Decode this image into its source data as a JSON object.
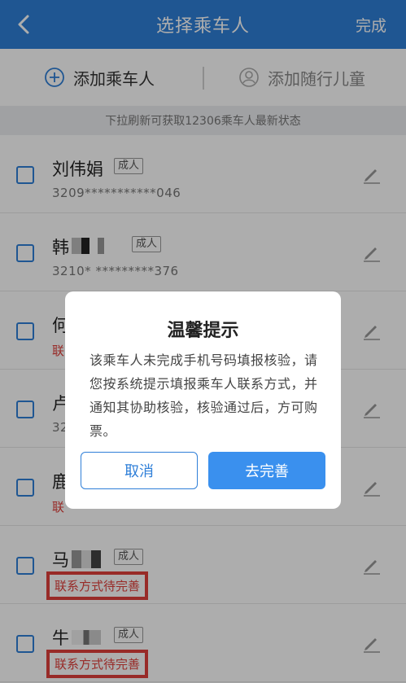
{
  "nav": {
    "title": "选择乘车人",
    "done_label": "完成"
  },
  "actions": {
    "add_passenger": "添加乘车人",
    "add_child": "添加随行儿童"
  },
  "tip": "下拉刷新可获取12306乘车人最新状态",
  "passengers": [
    {
      "name": "刘伟娟",
      "badge": "成人",
      "id": "3209***********046"
    },
    {
      "name": "韩",
      "badge": "成人",
      "id": "3210*   *********376"
    },
    {
      "name": "何",
      "badge": "",
      "warning": "联"
    },
    {
      "name": "卢",
      "badge": "",
      "id": "32"
    },
    {
      "name": "鹿",
      "badge": "",
      "warning": "联"
    },
    {
      "name": "马",
      "badge": "成人",
      "warning": "联系方式待完善"
    },
    {
      "name": "牛",
      "badge": "成人",
      "warning": "联系方式待完善"
    }
  ],
  "dialog": {
    "title": "温馨提示",
    "body": "该乘车人未完成手机号码填报核验，请您按系统提示填报乘车人联系方式，并通知其协助核验，核验通过后，方可购票。",
    "cancel_label": "取消",
    "confirm_label": "去完善"
  },
  "colors": {
    "primary": "#2f7fd8",
    "warning": "#e0403b"
  },
  "icons": {
    "back": "chevron-left-icon",
    "add": "plus-circle-icon",
    "child": "user-circle-icon",
    "edit": "pencil-icon"
  }
}
